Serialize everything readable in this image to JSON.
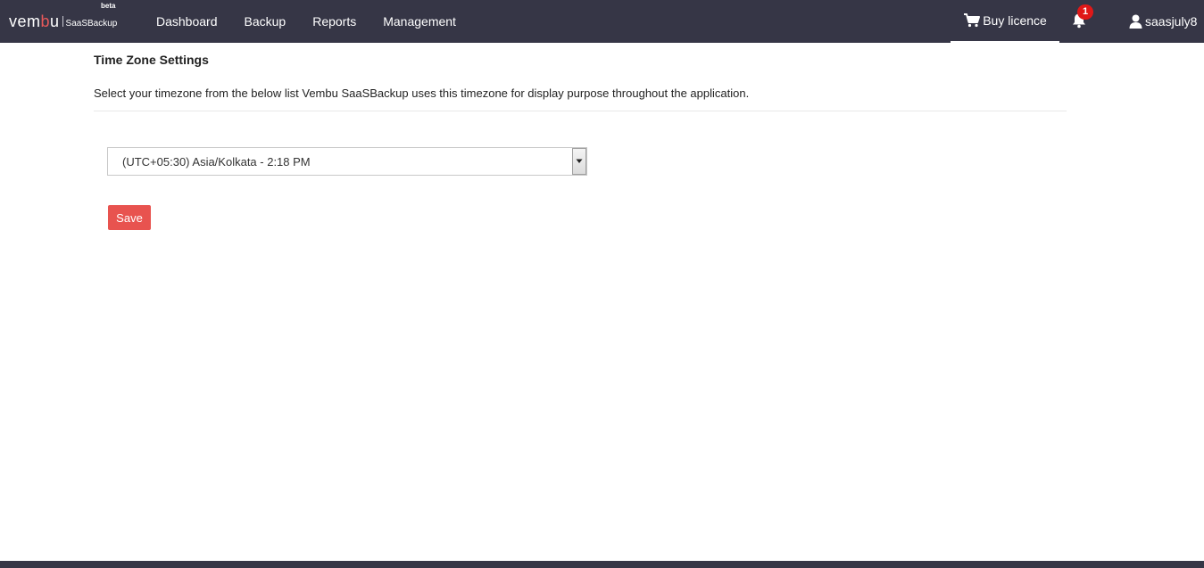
{
  "header": {
    "logo": {
      "brand_prefix": "vem",
      "brand_accent": "b",
      "brand_suffix": "u",
      "product": "SaaSBackup",
      "badge": "beta"
    },
    "nav": [
      {
        "label": "Dashboard"
      },
      {
        "label": "Backup"
      },
      {
        "label": "Reports"
      },
      {
        "label": "Management"
      }
    ],
    "buy_licence_label": "Buy licence",
    "notifications_count": "1",
    "username": "saasjuly8"
  },
  "main": {
    "title": "Time Zone Settings",
    "description": "Select your timezone from the below list Vembu SaaSBackup uses this timezone for display purpose throughout the application.",
    "timezone_select": {
      "selected": "(UTC+05:30) Asia/Kolkata - 2:18 PM"
    },
    "save_label": "Save"
  },
  "colors": {
    "topbar": "#363646",
    "accent": "#e8534f",
    "badge": "#e01818"
  },
  "icons": {
    "cart": "cart-icon",
    "bell": "bell-icon",
    "user": "user-icon",
    "dropdown": "chevron-down-icon"
  }
}
